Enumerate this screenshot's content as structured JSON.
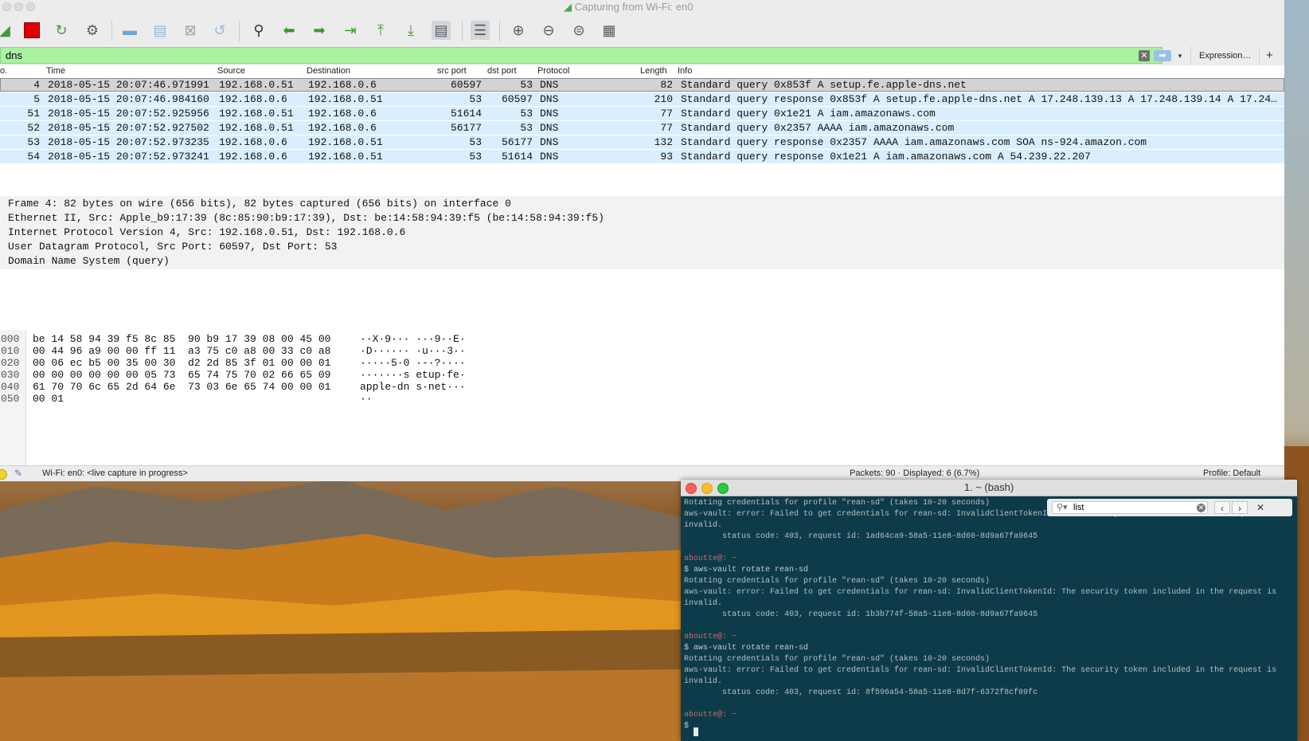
{
  "wireshark": {
    "title": "Capturing from Wi-Fi: en0",
    "filter": {
      "value": "dns",
      "expression_label": "Expression…",
      "add_label": "+"
    },
    "toolbar_icons": [
      "wireshark-fin-icon",
      "stop-capture-icon",
      "restart-capture-icon",
      "capture-options-icon",
      "open-file-icon",
      "save-file-icon",
      "close-file-icon",
      "reload-file-icon",
      "find-packet-icon",
      "go-back-icon",
      "go-forward-icon",
      "go-to-packet-icon",
      "first-packet-icon",
      "last-packet-icon",
      "auto-scroll-icon",
      "colorize-icon",
      "zoom-in-icon",
      "zoom-out-icon",
      "normal-size-icon",
      "resize-columns-icon"
    ],
    "columns": [
      "o.",
      "Time",
      "Source",
      "Destination",
      "src port",
      "dst port",
      "Protocol",
      "Length",
      "Info"
    ],
    "packets": [
      {
        "no": "4",
        "time": "2018-05-15 20:07:46.971991",
        "src": "192.168.0.51",
        "dst": "192.168.0.6",
        "sport": "60597",
        "dport": "53",
        "proto": "DNS",
        "len": "82",
        "info": "Standard query 0x853f A setup.fe.apple-dns.net"
      },
      {
        "no": "5",
        "time": "2018-05-15 20:07:46.984160",
        "src": "192.168.0.6",
        "dst": "192.168.0.51",
        "sport": "53",
        "dport": "60597",
        "proto": "DNS",
        "len": "210",
        "info": "Standard query response 0x853f A setup.fe.apple-dns.net A 17.248.139.13 A 17.248.139.14 A 17.24…"
      },
      {
        "no": "51",
        "time": "2018-05-15 20:07:52.925956",
        "src": "192.168.0.51",
        "dst": "192.168.0.6",
        "sport": "51614",
        "dport": "53",
        "proto": "DNS",
        "len": "77",
        "info": "Standard query 0x1e21 A iam.amazonaws.com"
      },
      {
        "no": "52",
        "time": "2018-05-15 20:07:52.927502",
        "src": "192.168.0.51",
        "dst": "192.168.0.6",
        "sport": "56177",
        "dport": "53",
        "proto": "DNS",
        "len": "77",
        "info": "Standard query 0x2357 AAAA iam.amazonaws.com"
      },
      {
        "no": "53",
        "time": "2018-05-15 20:07:52.973235",
        "src": "192.168.0.6",
        "dst": "192.168.0.51",
        "sport": "53",
        "dport": "56177",
        "proto": "DNS",
        "len": "132",
        "info": "Standard query response 0x2357 AAAA iam.amazonaws.com SOA ns-924.amazon.com"
      },
      {
        "no": "54",
        "time": "2018-05-15 20:07:52.973241",
        "src": "192.168.0.6",
        "dst": "192.168.0.51",
        "sport": "53",
        "dport": "51614",
        "proto": "DNS",
        "len": "93",
        "info": "Standard query response 0x1e21 A iam.amazonaws.com A 54.239.22.207"
      }
    ],
    "details": [
      "Frame 4: 82 bytes on wire (656 bits), 82 bytes captured (656 bits) on interface 0",
      "Ethernet II, Src: Apple_b9:17:39 (8c:85:90:b9:17:39), Dst: be:14:58:94:39:f5 (be:14:58:94:39:f5)",
      "Internet Protocol Version 4, Src: 192.168.0.51, Dst: 192.168.0.6",
      "User Datagram Protocol, Src Port: 60597, Dst Port: 53",
      "Domain Name System (query)"
    ],
    "bytes": [
      {
        "offset": "000",
        "hex": "be 14 58 94 39 f5 8c 85  90 b9 17 39 08 00 45 00",
        "ascii": "··X·9··· ···9··E·"
      },
      {
        "offset": "010",
        "hex": "00 44 96 a9 00 00 ff 11  a3 75 c0 a8 00 33 c0 a8",
        "ascii": "·D······ ·u···3··"
      },
      {
        "offset": "020",
        "hex": "00 06 ec b5 00 35 00 30  d2 2d 85 3f 01 00 00 01",
        "ascii": "·····5·0 ·-·?····"
      },
      {
        "offset": "030",
        "hex": "00 00 00 00 00 00 05 73  65 74 75 70 02 66 65 09",
        "ascii": "·······s etup·fe·"
      },
      {
        "offset": "040",
        "hex": "61 70 70 6c 65 2d 64 6e  73 03 6e 65 74 00 00 01",
        "ascii": "apple-dn s·net···"
      },
      {
        "offset": "050",
        "hex": "00 01",
        "ascii": "··"
      }
    ],
    "status": {
      "interface": "Wi-Fi: en0: <live capture in progress>",
      "packets": "Packets: 90 · Displayed: 6 (6.7%)",
      "profile": "Profile: Default"
    }
  },
  "terminal": {
    "title": "1. ~ (bash)",
    "search": {
      "value": "list"
    },
    "lines": [
      {
        "kind": "out",
        "text": "Rotating credentials for profile \"rean-sd\" (takes 10-20 seconds)"
      },
      {
        "kind": "out",
        "text": "aws-vault: error: Failed to get credentials for rean-sd: InvalidClientTokenId: The security token included in the request is"
      },
      {
        "kind": "out",
        "text": "invalid."
      },
      {
        "kind": "out",
        "text": "        status code: 403, request id: 1ad64ca9-58a5-11e8-8d60-8d9a67fa9645"
      },
      {
        "kind": "blank",
        "text": ""
      },
      {
        "kind": "prompt",
        "text": "aboutte@: ~"
      },
      {
        "kind": "cmd",
        "text": "$ aws-vault rotate rean-sd"
      },
      {
        "kind": "out",
        "text": "Rotating credentials for profile \"rean-sd\" (takes 10-20 seconds)"
      },
      {
        "kind": "out",
        "text": "aws-vault: error: Failed to get credentials for rean-sd: InvalidClientTokenId: The security token included in the request is"
      },
      {
        "kind": "out",
        "text": "invalid."
      },
      {
        "kind": "out",
        "text": "        status code: 403, request id: 1b3b774f-58a5-11e8-8d60-8d9a67fa9645"
      },
      {
        "kind": "blank",
        "text": ""
      },
      {
        "kind": "prompt",
        "text": "aboutte@: ~"
      },
      {
        "kind": "cmd",
        "text": "$ aws-vault rotate rean-sd"
      },
      {
        "kind": "out",
        "text": "Rotating credentials for profile \"rean-sd\" (takes 10-20 seconds)"
      },
      {
        "kind": "out",
        "text": "aws-vault: error: Failed to get credentials for rean-sd: InvalidClientTokenId: The security token included in the request is"
      },
      {
        "kind": "out",
        "text": "invalid."
      },
      {
        "kind": "out",
        "text": "        status code: 403, request id: 8f596a54-58a5-11e8-8d7f-6372f8cf09fc"
      },
      {
        "kind": "blank",
        "text": ""
      },
      {
        "kind": "prompt",
        "text": "aboutte@: ~"
      },
      {
        "kind": "cmd",
        "text": "$ "
      }
    ]
  },
  "colors": {
    "filter_valid": "#a9f2a0",
    "row_highlight": "#d9efff",
    "row_selected": "#d3d3d3",
    "terminal_bg": "#0e3b49"
  }
}
